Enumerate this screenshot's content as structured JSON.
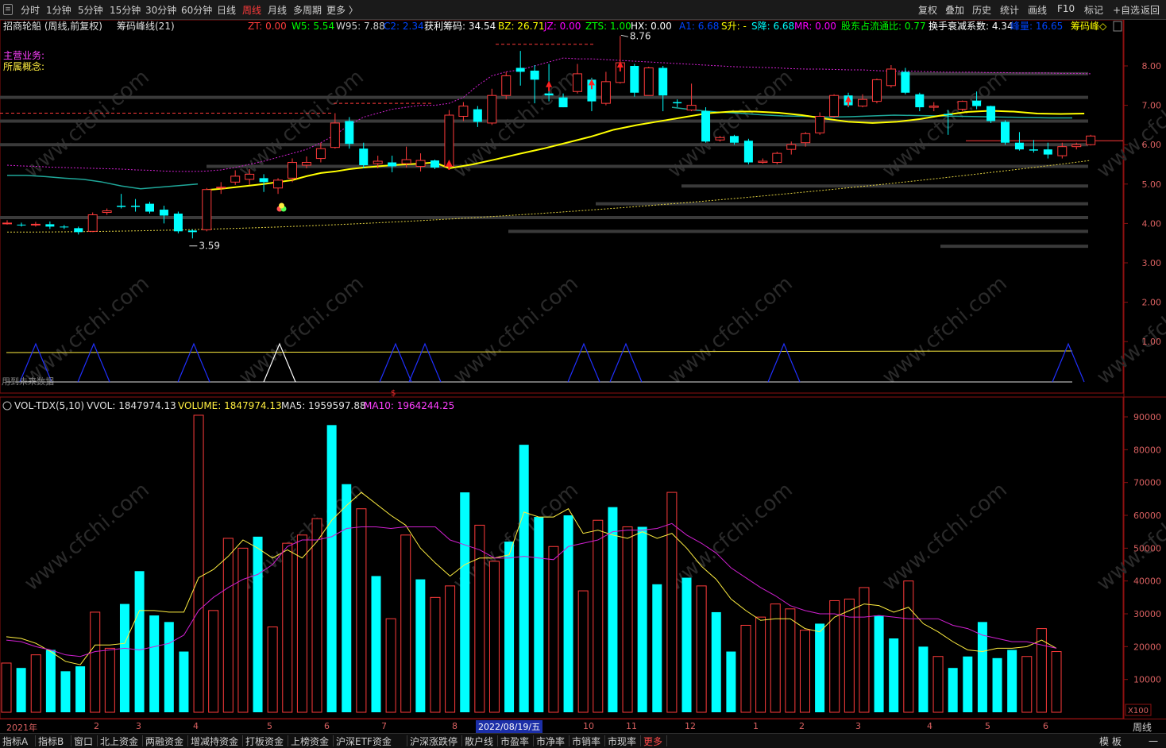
{
  "toolbar": {
    "periods": [
      "分时",
      "1分钟",
      "5分钟",
      "15分钟",
      "30分钟",
      "60分钟",
      "日线",
      "周线",
      "月线",
      "多周期",
      "更多 〉"
    ],
    "active_period": "周线",
    "right_buttons": [
      "复权",
      "叠加",
      "历史",
      "统计",
      "画线",
      "F10",
      "标记",
      "+自选",
      "返回"
    ]
  },
  "main_panel": {
    "stock_title": "招商轮船 (周线,前复权)",
    "indicator_name": "筹码峰线(21)",
    "stats": [
      {
        "label": "ZT: 0.00",
        "color": "#ff3b3b"
      },
      {
        "label": "W5: 5.54",
        "color": "#00ff00"
      },
      {
        "label": "W95: 7.88",
        "color": "#d0d0d0"
      },
      {
        "label": "C2: 2.34",
        "color": "#0044ff"
      },
      {
        "label": "获利筹码: 34.54",
        "color": "#ffffff"
      },
      {
        "label": "BZ: 26.71",
        "color": "#ffff00"
      },
      {
        "label": "JZ: 0.00",
        "color": "#ff00ff"
      },
      {
        "label": "ZTS: 1.00",
        "color": "#00ff00"
      },
      {
        "label": "HX: 0.00",
        "color": "#ffffff"
      },
      {
        "label": "A1: 6.68",
        "color": "#0044ff"
      },
      {
        "label": "S升: -",
        "color": "#ffff00"
      },
      {
        "label": "S降: 6.68",
        "color": "#00ffff"
      },
      {
        "label": "MR: 0.00",
        "color": "#ff00ff"
      },
      {
        "label": "股东占流通比: 0.77",
        "color": "#00ff00"
      },
      {
        "label": "换手衰减系数: 4.34",
        "color": "#ffffff"
      },
      {
        "label": "峰量: 16.65",
        "color": "#0044ff"
      },
      {
        "label": "筹码峰◇",
        "color": "#ffff00"
      }
    ],
    "main_business_label": "主营业务:",
    "concept_label": "所属概念:",
    "future_data_note": "用到未来数据",
    "high_label": "8.76",
    "low_label": "3.59",
    "signal_marker": "$",
    "watermark": "www.cfchi.com"
  },
  "volume_panel": {
    "title": "VOL-TDX(5,10)",
    "vvol": "VVOL: 1847974.13",
    "volume": "VOLUME: 1847974.13",
    "ma5": "MA5: 1959597.88",
    "ma10": "MA10: 1964244.25",
    "unit": "X100"
  },
  "time_axis": {
    "labels": [
      "2021年",
      "2",
      "3",
      "4",
      "5",
      "6",
      "7",
      "8",
      "10",
      "11",
      "12",
      "1",
      "2",
      "3",
      "4",
      "5",
      "6"
    ],
    "selected_date": "2022/08/19/五",
    "period_label": "周线"
  },
  "bottom_tabs": [
    "指标A",
    "指标B",
    "窗口",
    "北上资金",
    "两融资金",
    "增减持资金",
    "打板资金",
    "上榜资金",
    "沪深ETF资金",
    "沪深涨跌停",
    "散户线",
    "市盈率",
    "市净率",
    "市销率",
    "市现率",
    "更多"
  ],
  "bottom_right": [
    "模 板",
    "一"
  ],
  "colors": {
    "up": "#ff3b3b",
    "down": "#00ffff",
    "ma_yellow": "#ffff00",
    "ma_teal": "#1fa89a",
    "ma_magenta": "#d020d0",
    "axis_red": "#8b1010"
  },
  "chart_data": {
    "type": "candlestick",
    "price_axis": {
      "ticks": [
        "8.00",
        "7.00",
        "6.00",
        "5.00",
        "4.00",
        "3.00",
        "2.00",
        "1.00"
      ],
      "ylim": [
        0.6,
        9.0
      ]
    },
    "candles": [
      [
        3.99,
        4.01,
        4.08,
        3.97
      ],
      [
        3.97,
        3.96,
        4.02,
        3.92
      ],
      [
        3.96,
        3.98,
        4.04,
        3.92
      ],
      [
        3.98,
        3.92,
        4.05,
        3.86
      ],
      [
        3.92,
        3.9,
        3.96,
        3.86
      ],
      [
        3.88,
        3.78,
        3.92,
        3.72
      ],
      [
        3.8,
        4.22,
        4.28,
        3.78
      ],
      [
        4.28,
        4.32,
        4.38,
        4.22
      ],
      [
        4.45,
        4.42,
        4.75,
        4.38
      ],
      [
        4.45,
        4.42,
        4.62,
        4.3
      ],
      [
        4.5,
        4.3,
        4.55,
        4.25
      ],
      [
        4.35,
        4.2,
        4.45,
        4.0
      ],
      [
        4.25,
        3.8,
        4.3,
        3.75
      ],
      [
        3.82,
        3.78,
        3.85,
        3.62
      ],
      [
        3.84,
        4.86,
        4.9,
        3.8
      ],
      [
        4.9,
        4.92,
        5.05,
        4.75
      ],
      [
        5.05,
        5.2,
        5.35,
        4.98
      ],
      [
        5.12,
        5.25,
        5.38,
        4.98
      ],
      [
        5.15,
        5.05,
        5.25,
        4.8
      ],
      [
        4.9,
        5.1,
        5.15,
        4.75
      ],
      [
        5.15,
        5.55,
        5.65,
        5.05
      ],
      [
        5.48,
        5.55,
        5.7,
        5.4
      ],
      [
        5.65,
        5.9,
        6.05,
        5.55
      ],
      [
        5.93,
        6.55,
        6.8,
        5.9
      ],
      [
        6.6,
        6.02,
        6.7,
        5.9
      ],
      [
        5.9,
        5.48,
        6.05,
        5.4
      ],
      [
        5.52,
        5.58,
        5.72,
        5.4
      ],
      [
        5.55,
        5.45,
        5.72,
        5.3
      ],
      [
        5.52,
        5.62,
        5.95,
        5.42
      ],
      [
        5.45,
        5.6,
        5.78,
        5.32
      ],
      [
        5.6,
        5.42,
        5.62,
        5.38
      ],
      [
        5.45,
        6.75,
        6.88,
        5.4
      ],
      [
        6.72,
        6.98,
        7.08,
        6.6
      ],
      [
        6.9,
        6.58,
        6.98,
        6.45
      ],
      [
        6.55,
        7.25,
        7.42,
        6.5
      ],
      [
        7.25,
        7.75,
        7.85,
        7.15
      ],
      [
        7.95,
        7.85,
        8.38,
        7.5
      ],
      [
        7.88,
        7.65,
        8.02,
        7.05
      ],
      [
        7.3,
        7.25,
        8.05,
        7.1
      ],
      [
        7.2,
        6.95,
        7.3,
        6.95
      ],
      [
        7.35,
        7.8,
        8.05,
        7.3
      ],
      [
        7.65,
        7.1,
        7.7,
        6.85
      ],
      [
        7.05,
        7.6,
        7.85,
        7.0
      ],
      [
        7.58,
        8.08,
        8.76,
        7.55
      ],
      [
        8.0,
        7.32,
        8.05,
        7.22
      ],
      [
        7.25,
        7.95,
        7.98,
        7.25
      ],
      [
        7.95,
        7.25,
        8.0,
        6.85
      ],
      [
        7.08,
        7.05,
        7.15,
        6.95
      ],
      [
        6.88,
        7.0,
        7.55,
        6.85
      ],
      [
        6.85,
        6.08,
        6.95,
        6.05
      ],
      [
        6.12,
        6.18,
        6.22,
        6.08
      ],
      [
        6.22,
        6.05,
        6.25,
        6.0
      ],
      [
        6.1,
        5.55,
        6.15,
        5.5
      ],
      [
        5.55,
        5.58,
        5.65,
        5.52
      ],
      [
        5.55,
        5.78,
        5.82,
        5.5
      ],
      [
        5.88,
        6.0,
        6.08,
        5.75
      ],
      [
        6.05,
        6.28,
        6.32,
        5.95
      ],
      [
        6.3,
        6.72,
        6.82,
        6.25
      ],
      [
        6.72,
        7.25,
        7.28,
        6.68
      ],
      [
        7.25,
        7.0,
        7.32,
        6.95
      ],
      [
        6.98,
        7.15,
        7.28,
        6.95
      ],
      [
        7.1,
        7.65,
        7.68,
        7.05
      ],
      [
        7.5,
        7.92,
        8.02,
        7.45
      ],
      [
        7.85,
        7.32,
        7.95,
        7.28
      ],
      [
        7.28,
        6.95,
        7.32,
        6.85
      ],
      [
        6.95,
        6.98,
        7.08,
        6.85
      ],
      [
        6.78,
        6.75,
        6.88,
        6.25
      ],
      [
        6.9,
        7.1,
        7.12,
        6.85
      ],
      [
        7.12,
        6.98,
        7.35,
        6.9
      ],
      [
        6.98,
        6.6,
        6.99,
        6.55
      ],
      [
        6.58,
        6.05,
        6.62,
        6.0
      ],
      [
        6.05,
        5.88,
        6.32,
        5.85
      ],
      [
        5.88,
        5.85,
        6.12,
        5.8
      ],
      [
        5.88,
        5.75,
        6.05,
        5.65
      ],
      [
        5.72,
        5.95,
        6.05,
        5.65
      ],
      [
        5.95,
        6.0,
        6.05,
        5.88
      ],
      [
        6.0,
        6.22,
        6.25,
        5.98
      ]
    ],
    "ma_yellow": [
      5.4,
      5.5,
      5.63,
      5.77,
      5.9,
      6.05,
      6.2,
      6.38,
      6.5,
      6.6,
      6.7,
      6.8,
      6.84,
      6.84,
      6.81,
      6.75,
      6.66,
      6.58,
      6.55,
      6.58,
      6.65,
      6.75,
      6.83,
      6.86,
      6.84,
      6.79,
      6.78,
      6.79
    ],
    "ma_teal_start": [
      5.22,
      5.22,
      5.19,
      5.15,
      5.12,
      5.05,
      4.95,
      4.88,
      4.92,
      4.96,
      5.0
    ],
    "ma_teal_end": [
      6.95,
      6.88,
      6.83,
      6.8,
      6.76,
      6.73,
      6.72,
      6.7,
      6.71,
      6.73,
      6.75,
      6.74,
      6.73,
      6.72,
      6.71,
      6.7,
      6.69,
      6.68,
      6.68
    ],
    "support_lines": [
      7.8,
      7.2,
      6.6,
      6.0,
      5.45,
      4.95,
      4.5,
      4.15,
      3.8,
      3.42
    ],
    "volume": {
      "unit": "X100",
      "ticks": [
        "90000",
        "80000",
        "70000",
        "60000",
        "50000",
        "40000",
        "30000",
        "20000",
        "10000"
      ],
      "ylim": [
        0,
        95000
      ],
      "values": [
        15000,
        13500,
        17500,
        19000,
        12500,
        14000,
        30500,
        19500,
        33000,
        43000,
        29500,
        27500,
        18500,
        90500,
        31000,
        53000,
        50000,
        53500,
        26000,
        51500,
        54000,
        59000,
        87500,
        69500,
        62000,
        41500,
        28500,
        54000,
        40500,
        35000,
        38500,
        67000,
        57000,
        46000,
        52000,
        81500,
        59500,
        50500,
        60000,
        37000,
        58500,
        62500,
        56500,
        56500,
        39000,
        67000,
        41000,
        38500,
        30500,
        18500,
        26500,
        29000,
        33000,
        31500,
        25000,
        27000,
        34000,
        34500,
        38000,
        29500,
        22500,
        40000,
        20000,
        17000,
        13500,
        17000,
        27500,
        16500,
        19000,
        17000,
        25500,
        18500
      ],
      "ma5": [
        23000,
        22500,
        21000,
        18500,
        15500,
        14500,
        20500,
        20500,
        21000,
        31000,
        31000,
        30500,
        30500,
        41000,
        43500,
        47500,
        52500,
        50000,
        47000,
        49500,
        47000,
        52000,
        58500,
        63000,
        67000,
        63500,
        60000,
        57000,
        50000,
        45500,
        41500,
        45000,
        47000,
        47000,
        48000,
        61000,
        59500,
        59500,
        62000,
        54500,
        55500,
        54000,
        53000,
        55000,
        53000,
        54500,
        50000,
        44500,
        40500,
        34500,
        31000,
        28000,
        28500,
        28500,
        25500,
        24500,
        29000,
        31000,
        33000,
        32500,
        30500,
        32000,
        27000,
        24500,
        21500,
        19000,
        18500,
        19500,
        19500,
        20000,
        22000,
        19500
      ],
      "ma10": [
        22000,
        21500,
        20000,
        19000,
        17500,
        17000,
        18500,
        19000,
        19500,
        19000,
        20000,
        21000,
        23500,
        31000,
        35000,
        38000,
        40500,
        42000,
        45000,
        50500,
        52500,
        52500,
        53500,
        56000,
        56500,
        56500,
        56000,
        56500,
        56500,
        56500,
        52500,
        51000,
        49500,
        47000,
        47000,
        47500,
        47000,
        46500,
        50500,
        51500,
        52500,
        55000,
        55500,
        55500,
        56000,
        57500,
        54000,
        51500,
        48500,
        44000,
        41000,
        38000,
        35500,
        32500,
        31000,
        30000,
        30000,
        29000,
        29000,
        29500,
        29000,
        28500,
        28500,
        28500,
        26500,
        25500,
        23500,
        22500,
        21500,
        21500,
        20500,
        19500
      ]
    }
  }
}
